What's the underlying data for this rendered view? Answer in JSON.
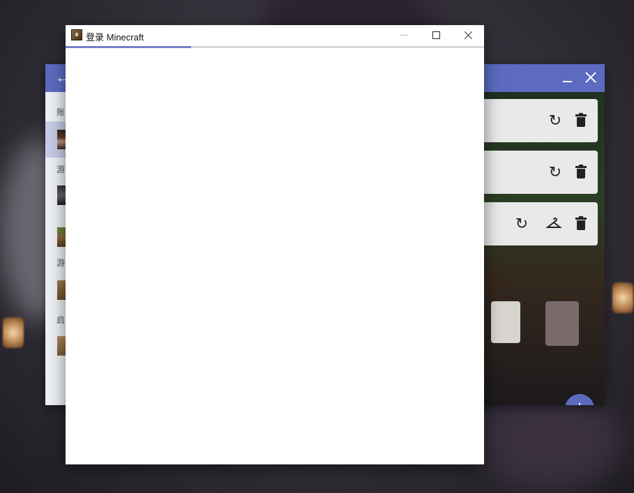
{
  "dialog": {
    "title": "登录 Minecraft",
    "loading_progress_percent": 30
  },
  "launcher": {
    "sidebar_labels": [
      "账",
      "游",
      "游",
      "启"
    ],
    "fab_label": "+",
    "back_glyph": "←",
    "icons": {
      "refresh": "refresh-icon",
      "delete": "trash-icon",
      "skin": "hanger-icon"
    }
  },
  "colors": {
    "accent": "#5c6bc0",
    "progress": "#7381c9",
    "card": "#e9e9e9"
  }
}
